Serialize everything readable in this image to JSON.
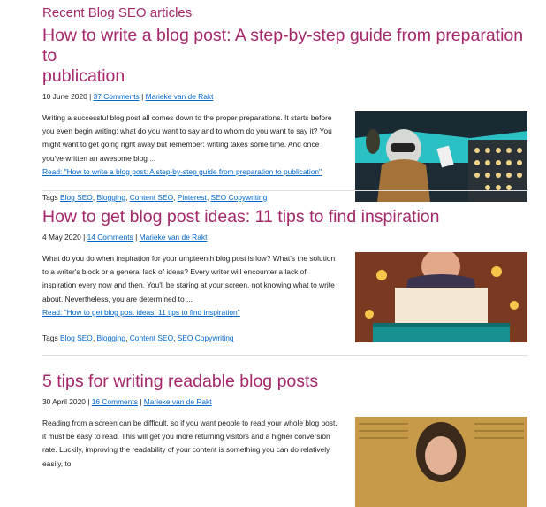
{
  "section": {
    "title": "Recent Blog SEO articles"
  },
  "articles": [
    {
      "title_line1": "How to write a blog post: A step-by-step guide from preparation to",
      "title_line2": "publication",
      "date": "10 June 2020",
      "comments": "37 Comments",
      "author": "Marieke van de Rakt",
      "excerpt": "Writing a successful blog post all comes down to the proper preparations. It starts before you even begin writing: what do you want to say and to whom do you want to say it? You might want to get going right away but remember: writing takes some time. And once you've written an awesome blog ...",
      "read_link": "Read: \"How to write a blog post: A step-by-step guide from preparation to publication\"",
      "tags_label": "Tags",
      "tags": [
        "Blog SEO",
        "Blogging",
        "Content SEO",
        "Pinterest",
        "SEO Copywriting"
      ]
    },
    {
      "title_line1": "How to get blog post ideas: 11 tips to find inspiration",
      "title_line2": "",
      "date": "4 May 2020",
      "comments": "14 Comments",
      "author": "Marieke van de Rakt",
      "excerpt": "What do you do when inspiration for your umpteenth blog post is low? What's the solution to a writer's block or a general lack of ideas? Every writer will encounter a lack of inspiration every now and then. You'll be staring at your screen, not knowing what to write about. Nevertheless, you are determined to ...",
      "read_link": "Read: \"How to get blog post ideas: 11 tips to find inspiration\"",
      "tags_label": "Tags",
      "tags": [
        "Blog SEO",
        "Blogging",
        "Content SEO",
        "SEO Copywriting"
      ]
    },
    {
      "title_line1": "5 tips for writing readable blog posts",
      "title_line2": "",
      "date": "30 April 2020",
      "comments": "16 Comments",
      "author": "Marieke van de Rakt",
      "excerpt": "Reading from a screen can be difficult, so if you want people to read your whole blog post, it must be easy to read. This will get you more returning visitors and a higher conversion rate. Luckily, improving the readability of your content is something you can do relatively easily, to"
    }
  ],
  "colors": {
    "accent": "#a4286a",
    "link": "#0066cc"
  }
}
